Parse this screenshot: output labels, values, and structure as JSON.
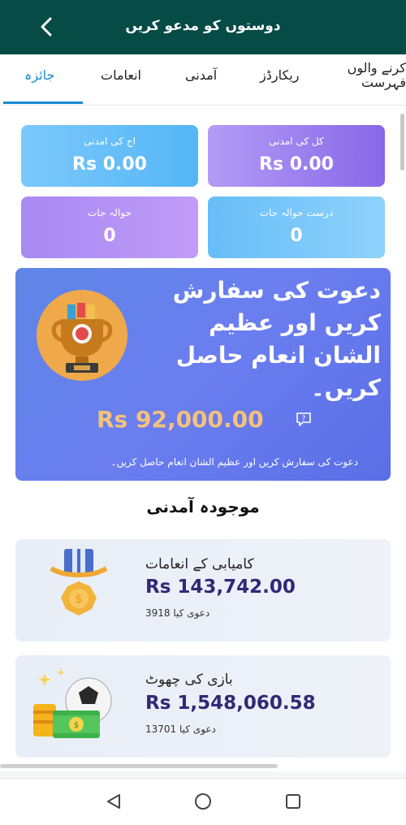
{
  "header": {
    "title": "دوستوں کو مدعو کریں"
  },
  "tabs": [
    {
      "label": "جائزہ",
      "active": true
    },
    {
      "label": "انعامات",
      "active": false
    },
    {
      "label": "آمدنی",
      "active": false
    },
    {
      "label": "ریکارڈز",
      "active": false
    },
    {
      "label_line1": "کرنے والوں",
      "label_line2": "فہرست",
      "active": false
    }
  ],
  "stats": {
    "today_earnings": {
      "label": "اج کی امدنی",
      "value": "Rs 0.00"
    },
    "total_earnings": {
      "label": "کل کی امدنی",
      "value": "Rs 0.00"
    },
    "referrals": {
      "label": "حوالہ جات",
      "value": "0"
    },
    "valid_referrals": {
      "label": "درست حوالہ جات",
      "value": "0"
    }
  },
  "banner": {
    "title": "دعوت کی سفارش کریں اور عظیم الشان انعام حاصل کریں۔",
    "amount": "Rs 92,000.00",
    "subtitle": "دعوت کی سفارش کریں اور عظیم الشان انعام حاصل کریں۔"
  },
  "section": {
    "title": "موجودہ آمدنی"
  },
  "cards": [
    {
      "name": "کامیابی کے انعامات",
      "amount": "Rs 143,742.00",
      "claim": "3918 دعوی کیا",
      "icon": "medal-icon"
    },
    {
      "name": "بازی کی چھوٹ",
      "amount": "Rs 1,548,060.58",
      "claim": "13701 دعوی کیا",
      "icon": "coins-ball-icon"
    }
  ],
  "colors": {
    "header": "#064b46",
    "accent": "#1a8ad2",
    "amount": "#2f2a76",
    "banner_amount": "#f6c27a"
  }
}
